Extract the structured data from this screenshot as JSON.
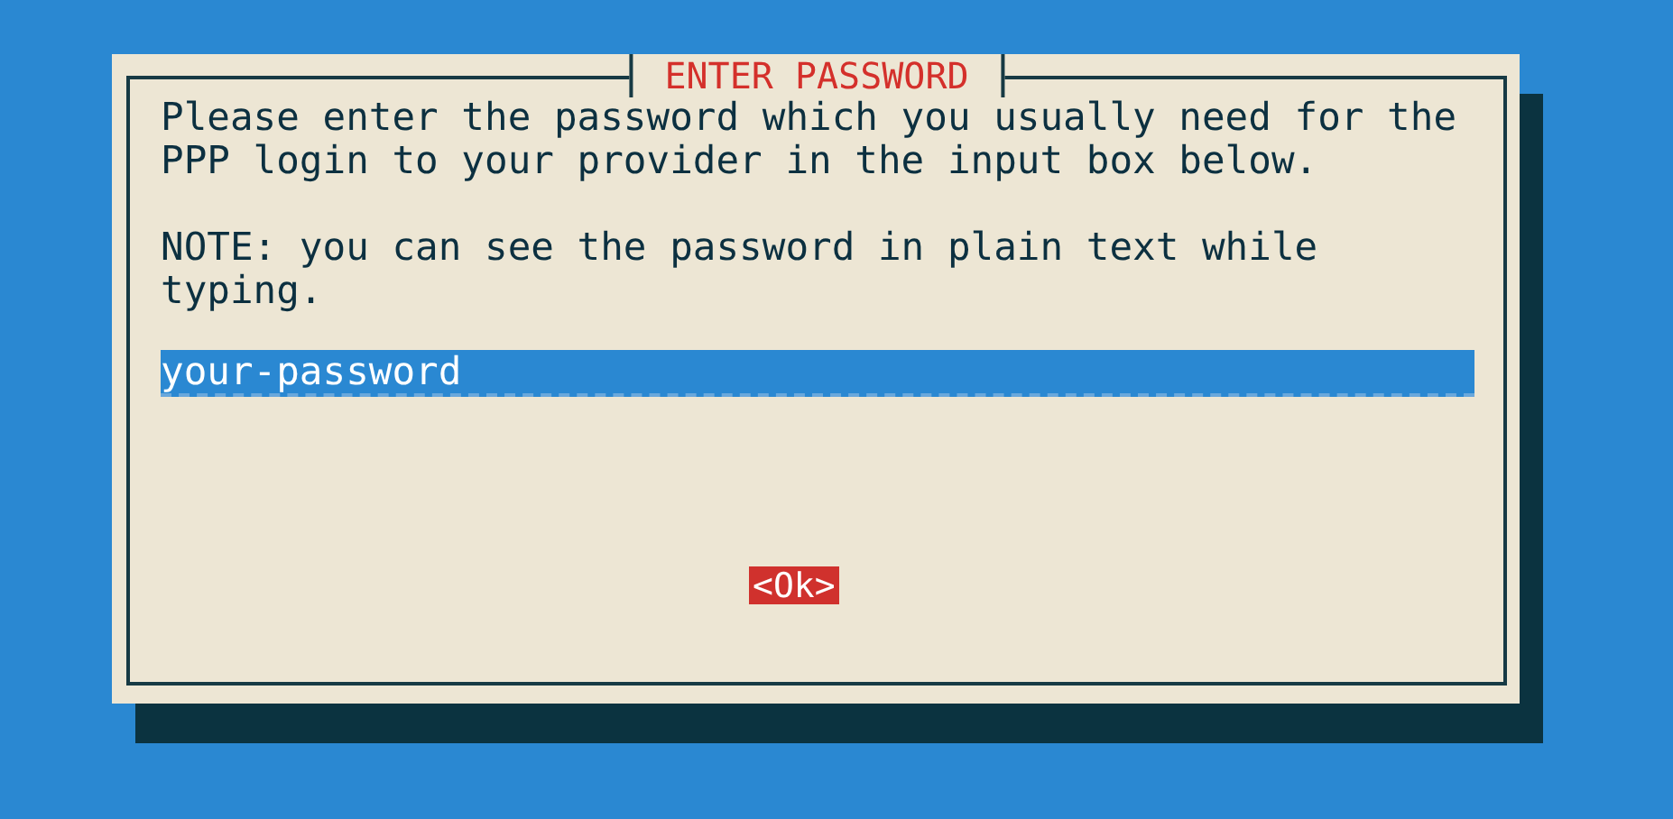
{
  "dialog": {
    "title": "ENTER PASSWORD",
    "paragraphs": [
      "Please enter the password which you usually need for the PPP login to your provider in the input box below.",
      "NOTE: you can see the password in plain text while typing."
    ],
    "input": {
      "value": "your-password"
    },
    "buttons": [
      {
        "label": "<Ok>",
        "selected": true
      }
    ]
  }
}
